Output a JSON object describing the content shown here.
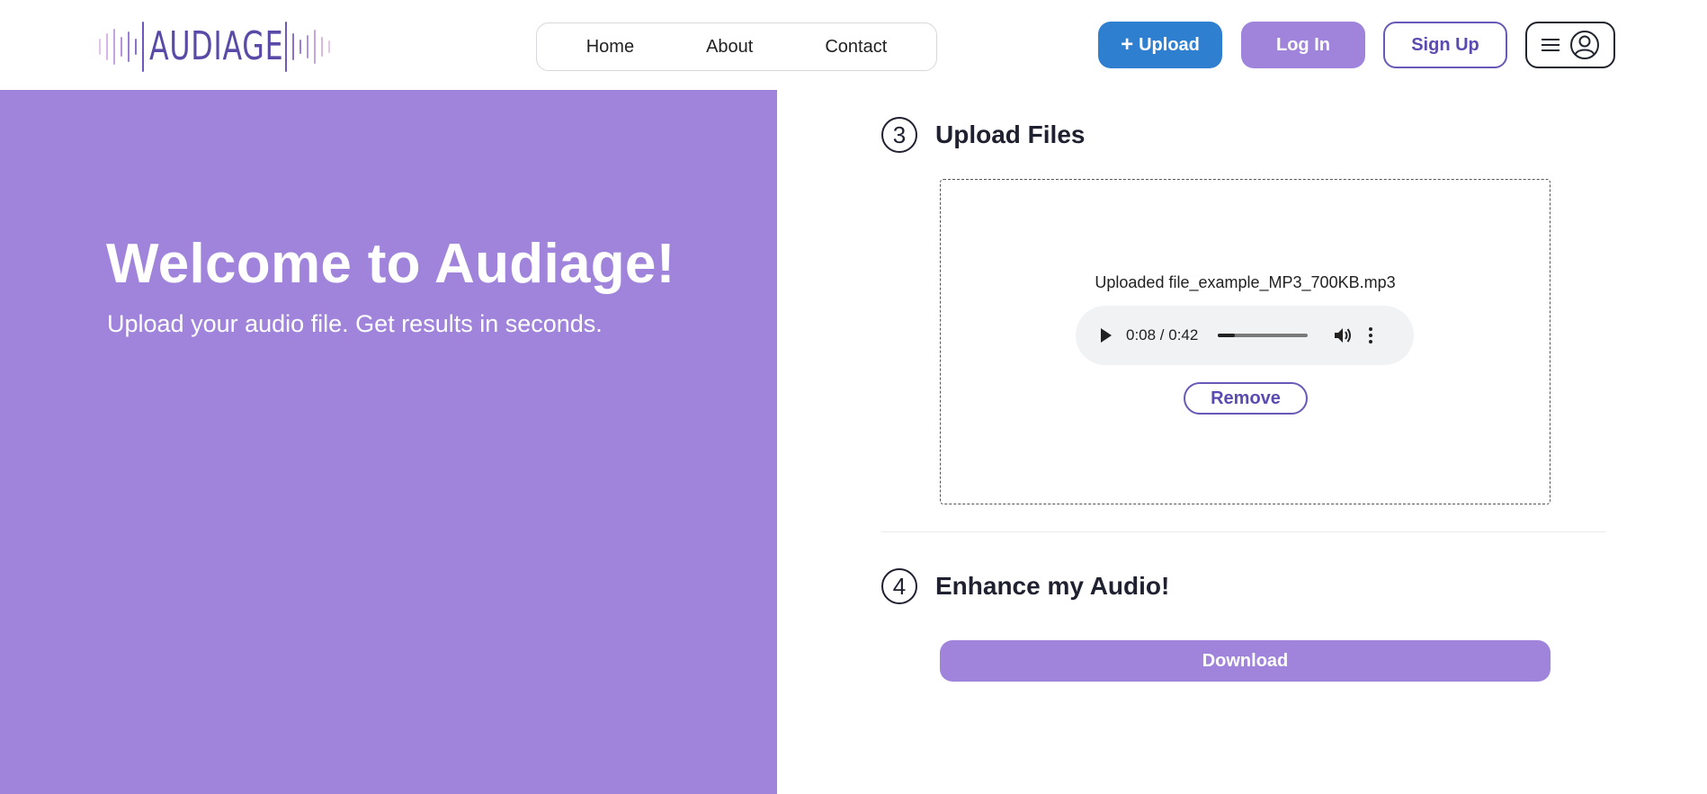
{
  "brand": {
    "name": "AUDIAGE",
    "accent": "#a084db",
    "ink": "#5a4aa8"
  },
  "nav": {
    "items": [
      {
        "label": "Home"
      },
      {
        "label": "About"
      },
      {
        "label": "Contact"
      }
    ]
  },
  "header": {
    "upload_plus": "+",
    "upload_label": "Upload",
    "login_label": "Log In",
    "signup_label": "Sign Up",
    "menu_icon": "hamburger-icon",
    "account_icon": "user-circle-icon"
  },
  "hero": {
    "title": "Welcome to Audiage!",
    "subtitle": "Upload your audio file. Get results in seconds."
  },
  "steps": {
    "upload": {
      "number": "3",
      "title": "Upload Files",
      "file_label": "Uploaded file_example_MP3_700KB.mp3",
      "player": {
        "time": "0:08 / 0:42",
        "progress": 0.19
      },
      "remove_label": "Remove"
    },
    "enhance": {
      "number": "4",
      "title": "Enhance my Audio!",
      "download_label": "Download"
    }
  },
  "colors": {
    "upload_button": "#2f7fd0",
    "hero_bg": "#a084db",
    "outline_purple": "#6a58b8"
  }
}
